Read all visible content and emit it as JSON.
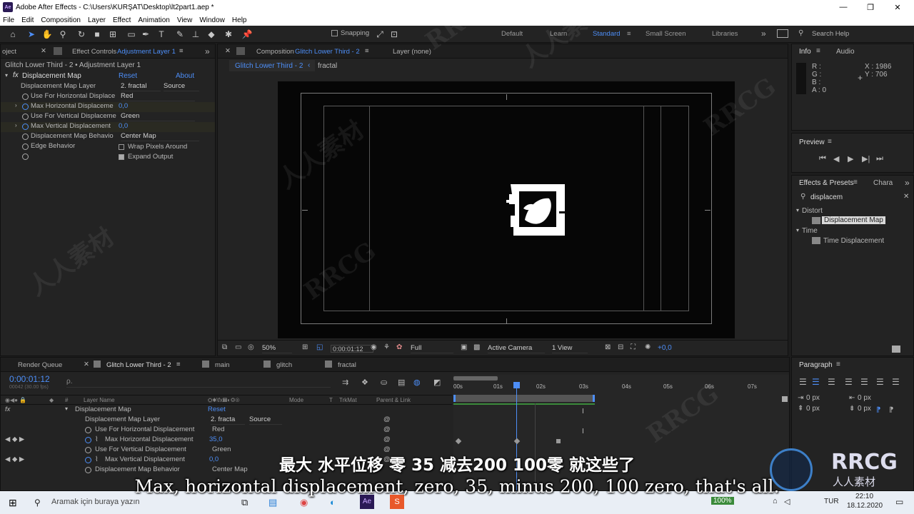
{
  "window": {
    "title": "Adobe After Effects - C:\\Users\\KURŞAT\\Desktop\\lt2part1.aep *",
    "app_logo": "Ae",
    "minimize": "—",
    "maximize": "❐",
    "close": "✕"
  },
  "menu": [
    "File",
    "Edit",
    "Composition",
    "Layer",
    "Effect",
    "Animation",
    "View",
    "Window",
    "Help"
  ],
  "toolbar": {
    "snapping_label": "Snapping",
    "workspaces": [
      "Default",
      "Learn",
      "Standard",
      "Small Screen",
      "Libraries"
    ],
    "more_icon": "»",
    "search_help": "Search Help"
  },
  "left_panel": {
    "project_tab": "oject",
    "tab_label": "Effect Controls",
    "tab_layer": "Adjustment Layer 1",
    "breadcrumb": "Glitch Lower Third - 2 • Adjustment Layer 1",
    "effect_name": "Displacement Map",
    "reset": "Reset",
    "about": "About",
    "props": [
      {
        "label": "Displacement Map Layer",
        "value": "2. fractal",
        "value2": "Source"
      },
      {
        "label": "Use For Horizontal Displace",
        "value": "Red"
      },
      {
        "label": "Max Horizontal Displaceme",
        "value": "0,0"
      },
      {
        "label": "Use For Vertical Displaceme",
        "value": "Green"
      },
      {
        "label": "Max Vertical Displacement",
        "value": "0,0"
      },
      {
        "label": "Displacement Map Behavio",
        "value": "Center Map"
      },
      {
        "label": "Edge Behavior",
        "value": "Wrap Pixels Around"
      },
      {
        "label": "",
        "value": "Expand Output"
      }
    ]
  },
  "composition": {
    "tab_label": "Composition",
    "tab_comp": "Glitch Lower Third - 2",
    "layer_tab": "Layer  (none)",
    "crumbs": [
      "Glitch Lower Third - 2",
      "fractal"
    ],
    "zoom": "50%",
    "timecode": "0:00:01:12",
    "resolution": "Full",
    "camera": "Active Camera",
    "views": "1 View",
    "exposure": "+0,0"
  },
  "info": {
    "tab": "Info",
    "audio_tab": "Audio",
    "r": "R :",
    "g": "G :",
    "b": "B :",
    "a": "A :  0",
    "x": "X : 1986",
    "y": "Y : 706"
  },
  "preview": {
    "tab": "Preview"
  },
  "effects_presets": {
    "tab": "Effects & Presets",
    "tab2": "Chara",
    "search": "displacem",
    "groups": [
      {
        "name": "Distort",
        "item": "Displacement Map"
      },
      {
        "name": "Time",
        "item": "Time Displacement"
      }
    ]
  },
  "paragraph": {
    "tab": "Paragraph",
    "fields": [
      "0 px",
      "0 px",
      "0 px",
      "0 px",
      "0 px"
    ]
  },
  "timeline": {
    "tabs": [
      "Render Queue",
      "Glitch Lower Third - 2",
      "main",
      "glitch",
      "fractal"
    ],
    "timecode": "0:00:01:12",
    "frames": "00042 (30.00 fps)",
    "search_placeholder": "ρ.",
    "col_layer_name": "Layer Name",
    "col_mode": "Mode",
    "col_t": "T",
    "col_trkmat": "TrkMat",
    "col_parent": "Parent & Link",
    "ruler": [
      "00s",
      "01s",
      "02s",
      "03s",
      "04s",
      "05s",
      "06s",
      "07s"
    ],
    "rows": [
      {
        "label": "Displacement Map",
        "value": "Reset",
        "blue": true
      },
      {
        "label": "Displacement Map Layer",
        "value": "2. fracta",
        "value2": "Source"
      },
      {
        "label": "Use For Horizontal Displacement",
        "value": "Red"
      },
      {
        "label": "Max Horizontal Displacement",
        "value": "35,0",
        "blue": true
      },
      {
        "label": "Use For Vertical Displacement",
        "value": "Green"
      },
      {
        "label": "Max Vertical Displacement",
        "value": "0,0",
        "blue": true
      },
      {
        "label": "Displacement Map Behavior",
        "value": "Center Map"
      }
    ]
  },
  "subtitles": {
    "chinese": "最大 水平位移 零 35 减去200 100零 就这些了",
    "english": "Max, horizontal displacement, zero, 35, minus 200, 100 zero, that's all."
  },
  "taskbar": {
    "search": "Aramak için buraya yazın",
    "battery": "100%",
    "lang": "TUR",
    "time": "22:10",
    "date": "18.12.2020"
  },
  "watermarks": {
    "main": "RRCG",
    "sub": "人人素材"
  },
  "colors": {
    "accent": "#4d8ef7",
    "bg": "#1d1d1d",
    "panel": "#232323"
  }
}
